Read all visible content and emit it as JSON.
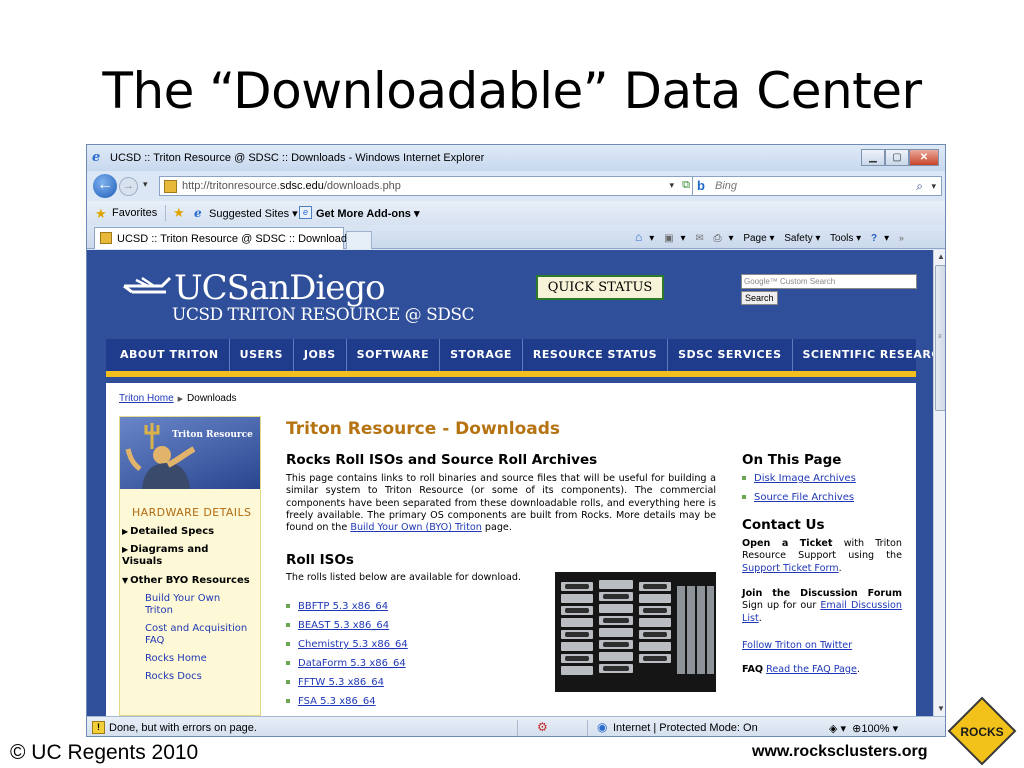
{
  "slide": {
    "title": "The “Downloadable” Data Center",
    "footer_left": "© UC Regents 2010",
    "footer_right": "www.rocksclusters.org",
    "logo_text": "ROCKS"
  },
  "browser": {
    "window_title": "UCSD :: Triton Resource @ SDSC :: Downloads - Windows Internet Explorer",
    "url_prefix": "http://tritonresource.",
    "url_host": "sdsc.edu",
    "url_path": "/downloads.php",
    "search_placeholder": "Bing",
    "favorites": {
      "favorites_label": "Favorites",
      "suggested_label": "Suggested Sites ▾",
      "addons_label": "Get More Add-ons ▾"
    },
    "tab_title": "UCSD :: Triton Resource @ SDSC :: Downloads",
    "commands": {
      "page": "Page ▾",
      "safety": "Safety ▾",
      "tools": "Tools ▾"
    },
    "status": {
      "text": "Done, but with errors on page.",
      "zone": "Internet | Protected Mode: On",
      "zoom": "100%"
    }
  },
  "site": {
    "logo_text": "UCSanDiego",
    "subtitle": "UCSD TRITON RESOURCE @ SDSC",
    "quick_status": "QUICK STATUS",
    "search_label": "Google™ Custom Search",
    "search_button": "Search",
    "nav": [
      "ABOUT TRITON",
      "USERS",
      "JOBS",
      "SOFTWARE",
      "STORAGE",
      "RESOURCE STATUS",
      "SDSC SERVICES",
      "SCIENTIFIC RESEARCH"
    ],
    "breadcrumb": {
      "home": "Triton Home",
      "current": "Downloads"
    },
    "sidebar": {
      "banner": "Triton Resource",
      "heading": "HARDWARE DETAILS",
      "items": [
        {
          "label": "Detailed Specs",
          "arrow": "▶"
        },
        {
          "label": "Diagrams and Visuals",
          "arrow": "▶"
        },
        {
          "label": "Other BYO Resources",
          "arrow": "▼"
        }
      ],
      "subitems": [
        "Build Your Own Triton",
        "Cost and Acquisition FAQ",
        "Rocks Home",
        "Rocks Docs"
      ]
    },
    "main": {
      "title": "Triton Resource - Downloads",
      "archives_heading": "Rocks Roll ISOs and Source Roll Archives",
      "archives_text": "This page contains links to roll binaries and source files that will be useful for building a similar system to Triton Resource (or some of its components). The commercial components have been separated from these downloadable rolls, and everything here is freely available. The primary OS components are built from Rocks. More details may be found on the",
      "archives_link": "Build Your Own (BYO) Triton",
      "archives_tail": "page.",
      "rolls_heading": "Roll ISOs",
      "rolls_intro": "The rolls listed below are available for download.",
      "rolls": [
        "BBFTP 5.3 x86_64",
        "BEAST 5.3 x86_64",
        "Chemistry 5.3 x86_64",
        "DataForm 5.3 x86_64",
        "FFTW 5.3 x86_64",
        "FSA 5.3 x86_64"
      ]
    },
    "right": {
      "on_this_page": "On This Page",
      "links": [
        "Disk Image Archives",
        "Source File Archives"
      ],
      "contact_heading": "Contact Us",
      "ticket_bold": "Open a Ticket",
      "ticket_text": "with Triton Resource Support using the",
      "ticket_link": "Support Ticket Form",
      "forum_bold": "Join the Discussion Forum",
      "forum_text": "Sign up for our",
      "forum_link": "Email Discussion List",
      "twitter_link": "Follow Triton on Twitter",
      "faq_bold": "FAQ",
      "faq_link": "Read the FAQ Page"
    }
  }
}
